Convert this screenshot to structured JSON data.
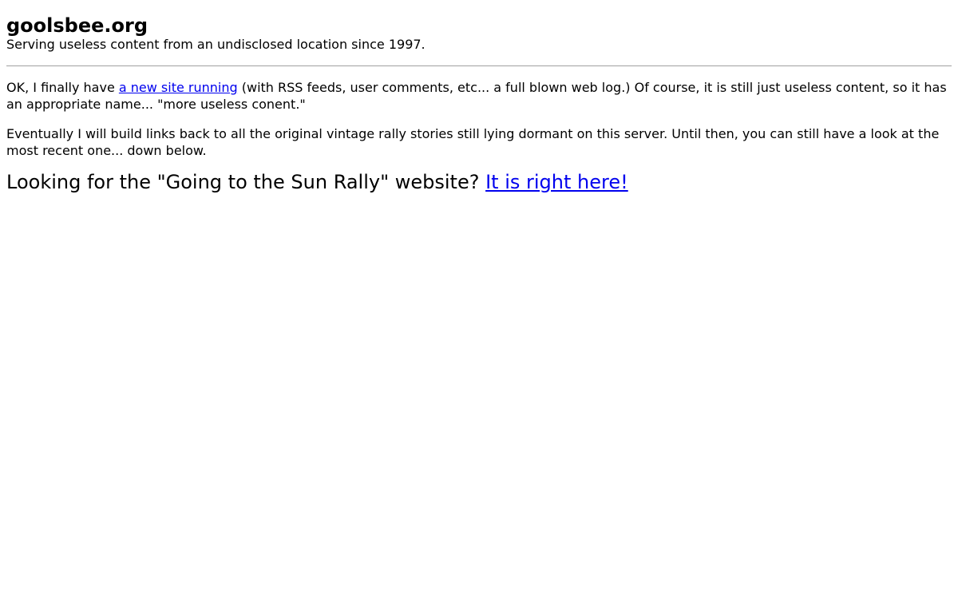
{
  "header": {
    "title": "goolsbee.org",
    "tagline": "Serving useless content from an undisclosed location since 1997."
  },
  "content": {
    "para1": {
      "before_link": "OK, I finally have ",
      "link_text": "a new site running",
      "after_link": " (with RSS feeds, user comments, etc... a full blown web log.) Of course, it is still just useless content, so it has an appropriate name... \"more useless conent.\""
    },
    "para2": "Eventually I will build links back to all the original vintage rally stories still lying dormant on this server. Until then, you can still have a look at the most recent one... down below.",
    "callout": {
      "text": "Looking for the \"Going to the Sun Rally\" website? ",
      "link_text": "It is right here!"
    }
  },
  "colors": {
    "link": "#0000ee",
    "rule": "#a0a0a0"
  }
}
